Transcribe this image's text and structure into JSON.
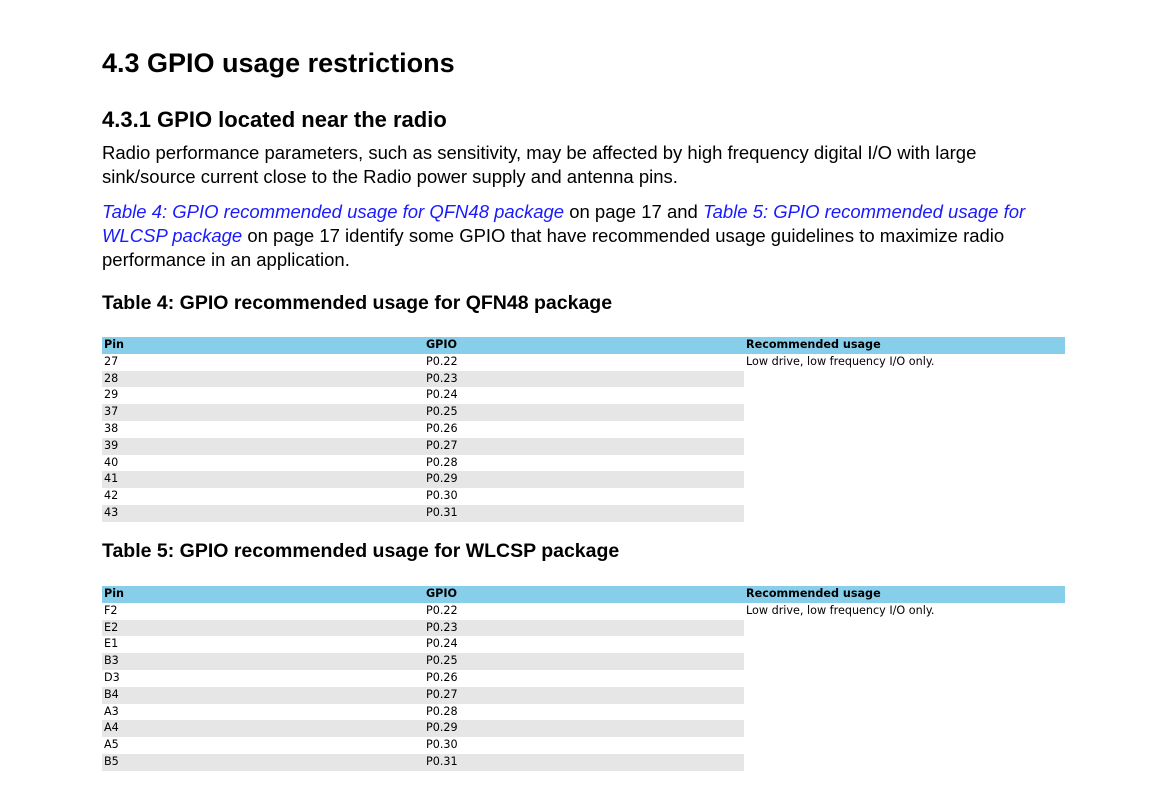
{
  "section_title": "4.3 GPIO usage restrictions",
  "subsection_title": "4.3.1 GPIO located near the radio",
  "paragraph1": "Radio performance parameters, such as sensitivity, may be affected by high frequency digital I/O with large sink/source current close to the Radio power supply and antenna pins.",
  "paragraph2": {
    "link1": "Table 4: GPIO recommended usage for QFN48 package",
    "text1": " on page 17 and ",
    "link2": "Table 5: GPIO recommended usage for WLCSP package",
    "text2": " on page 17 identify some GPIO that have recommended usage guidelines to maximize radio performance in an application."
  },
  "table4": {
    "title": "Table 4: GPIO recommended usage for QFN48 package",
    "headers": [
      "Pin",
      "GPIO",
      "Recommended usage"
    ],
    "usage": "Low drive, low frequency I/O only.",
    "rows": [
      {
        "pin": "27",
        "gpio": "P0.22"
      },
      {
        "pin": "28",
        "gpio": "P0.23"
      },
      {
        "pin": "29",
        "gpio": "P0.24"
      },
      {
        "pin": "37",
        "gpio": "P0.25"
      },
      {
        "pin": "38",
        "gpio": "P0.26"
      },
      {
        "pin": "39",
        "gpio": "P0.27"
      },
      {
        "pin": "40",
        "gpio": "P0.28"
      },
      {
        "pin": "41",
        "gpio": "P0.29"
      },
      {
        "pin": "42",
        "gpio": "P0.30"
      },
      {
        "pin": "43",
        "gpio": "P0.31"
      }
    ]
  },
  "table5": {
    "title": "Table 5: GPIO recommended usage for WLCSP package",
    "headers": [
      "Pin",
      "GPIO",
      "Recommended usage"
    ],
    "usage": "Low drive, low frequency I/O only.",
    "rows": [
      {
        "pin": "F2",
        "gpio": "P0.22"
      },
      {
        "pin": "E2",
        "gpio": "P0.23"
      },
      {
        "pin": "E1",
        "gpio": "P0.24"
      },
      {
        "pin": "B3",
        "gpio": "P0.25"
      },
      {
        "pin": "D3",
        "gpio": "P0.26"
      },
      {
        "pin": "B4",
        "gpio": "P0.27"
      },
      {
        "pin": "A3",
        "gpio": "P0.28"
      },
      {
        "pin": "A4",
        "gpio": "P0.29"
      },
      {
        "pin": "A5",
        "gpio": "P0.30"
      },
      {
        "pin": "B5",
        "gpio": "P0.31"
      }
    ]
  },
  "colors": {
    "header_bg": "#87ceeb",
    "row_shade": "#e6e6e6",
    "link": "#1a1aff"
  }
}
